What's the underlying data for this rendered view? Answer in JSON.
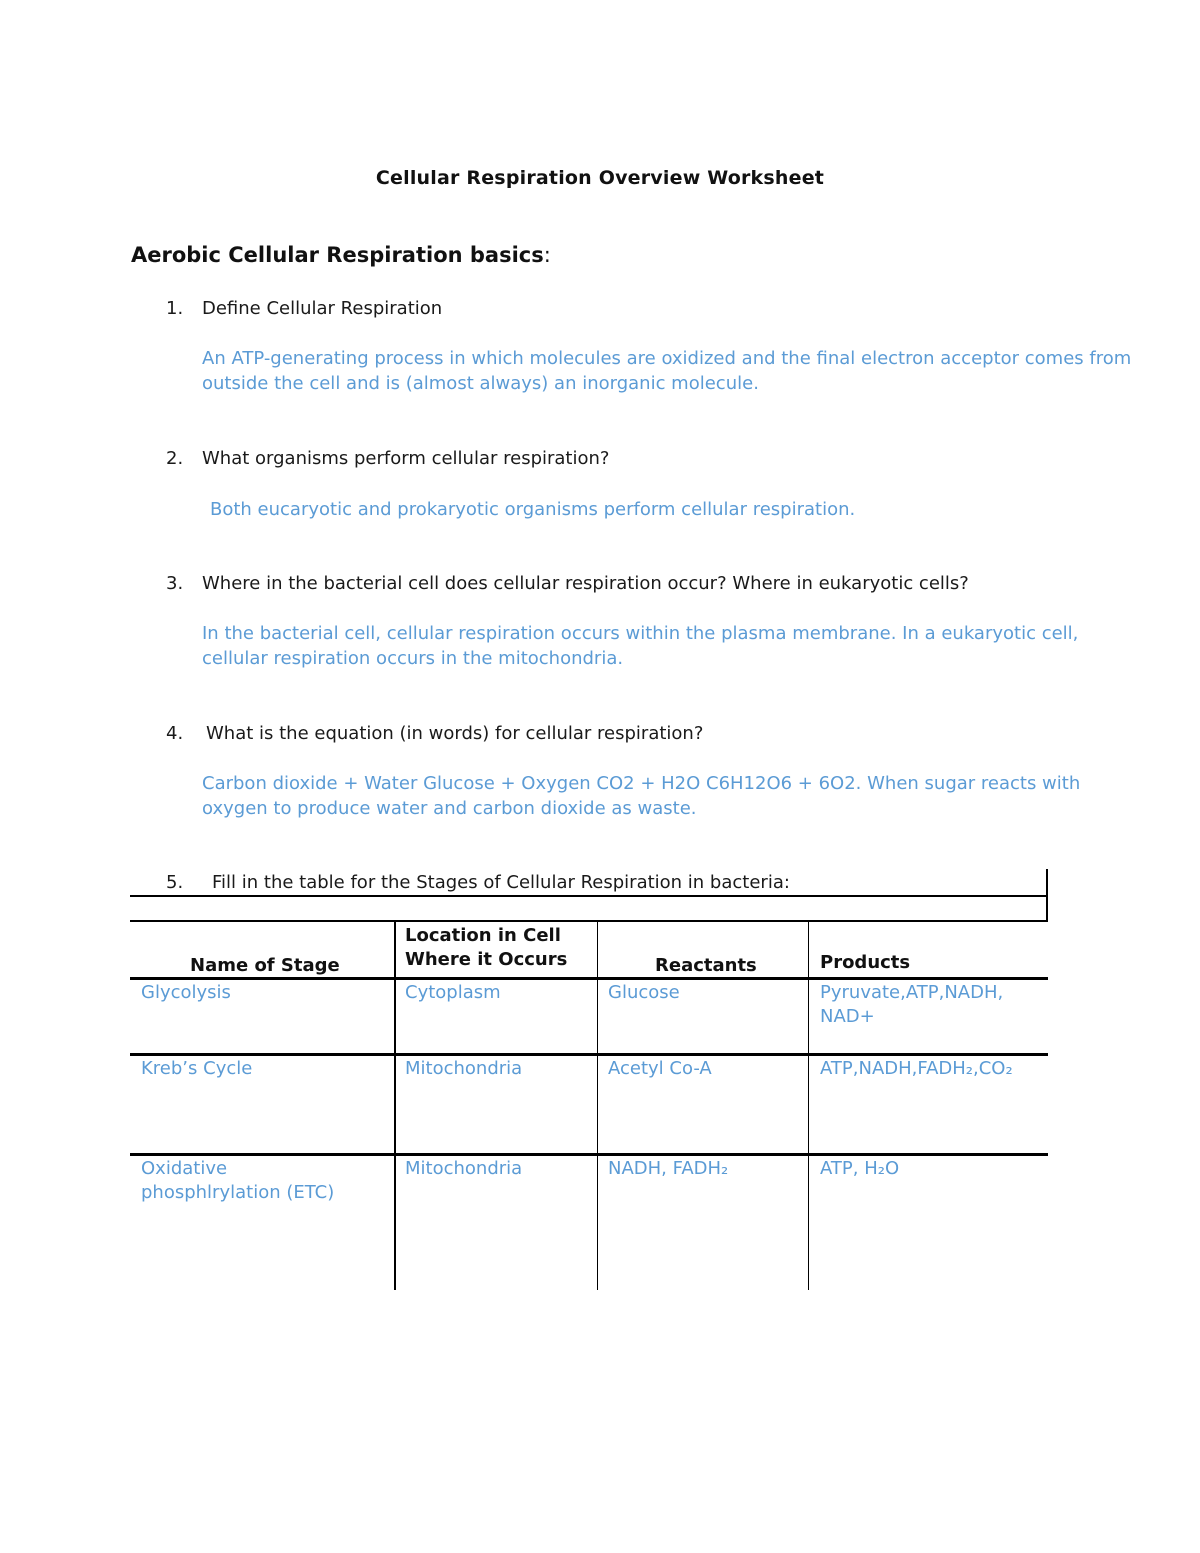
{
  "title": "Cellular Respiration Overview Worksheet",
  "section_heading": "Aerobic Cellular Respiration basics",
  "section_colon": ":",
  "questions": [
    {
      "num": "1.",
      "text": "Define Cellular Respiration",
      "answer": "An ATP-generating process in which molecules are oxidized and the final electron acceptor comes from outside the cell and is (almost always) an inorganic molecule."
    },
    {
      "num": "2.",
      "text": "What organisms perform cellular respiration?",
      "answer": "Both eucaryotic and prokaryotic organisms perform cellular respiration."
    },
    {
      "num": "3.",
      "text": "Where in the bacterial cell does cellular respiration occur? Where in eukaryotic cells?",
      "answer": "In the bacterial cell, cellular respiration occurs within the plasma membrane.  In a eukaryotic cell, cellular respiration occurs in the mitochondria."
    },
    {
      "num": "4.",
      "text": "What is the equation (in words) for cellular respiration?",
      "answer": "Carbon dioxide + Water Glucose + Oxygen CO2 + H2O C6H12O6 + 6O2.  When sugar reacts with oxygen to produce water and carbon dioxide as waste."
    },
    {
      "num": "5.",
      "text": "Fill in the table for the Stages of Cellular Respiration in bacteria:"
    }
  ],
  "table": {
    "headers": [
      "Name of Stage",
      "Location in Cell Where it Occurs",
      "Reactants",
      "Products"
    ],
    "header_location_line1": "Location in Cell",
    "header_location_line2": "Where it Occurs",
    "rows": [
      {
        "stage": "Glycolysis",
        "location": "Cytoplasm",
        "reactants": "Glucose",
        "products": "Pyruvate,ATP,NADH, NAD+"
      },
      {
        "stage": "Kreb’s Cycle",
        "location": "Mitochondria",
        "reactants": "Acetyl Co-A",
        "products": "ATP,NADH,FADH₂,CO₂"
      },
      {
        "stage": "Oxidative phosphlrylation (ETC)",
        "location": "Mitochondria",
        "reactants": "NADH, FADH₂",
        "products": "ATP, H₂O"
      }
    ]
  },
  "colors": {
    "answer": "#5b9bd5",
    "text": "#111111"
  }
}
